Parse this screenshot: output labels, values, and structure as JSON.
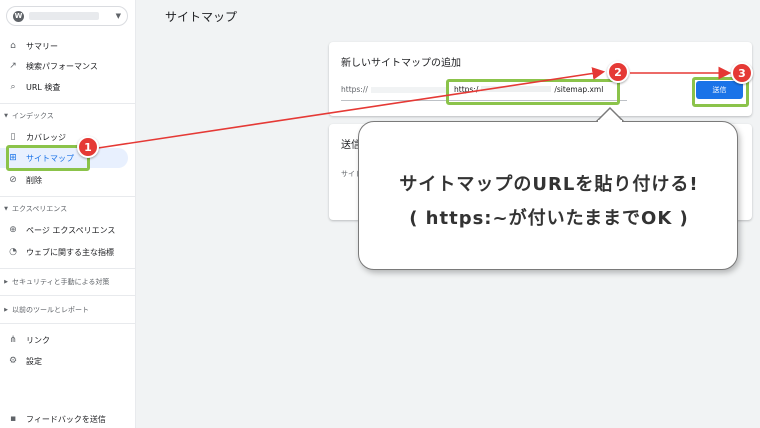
{
  "sidebar": {
    "property_icon": "W",
    "items": {
      "summary": "サマリー",
      "performance": "検索パフォーマンス",
      "url_inspect": "URL 検査",
      "coverage": "カバレッジ",
      "sitemaps": "サイトマップ",
      "removals": "削除",
      "page_experience": "ページ エクスペリエンス",
      "web_vitals": "ウェブに関する主な指標",
      "links": "リンク",
      "settings": "設定",
      "feedback": "フィードバックを送信"
    },
    "sections": {
      "index": "インデックス",
      "experience": "エクスペリエンス",
      "security": "セキュリティと手動による対策",
      "legacy": "以前のツールとレポート"
    }
  },
  "main": {
    "page_title": "サイトマップ",
    "add_card": {
      "title": "新しいサイトマップの追加",
      "url_prefix": "https://",
      "field_prefix": "https:/",
      "field_suffix": "/sitemap.xml",
      "submit_label": "送信"
    },
    "submitted_card": {
      "title": "送信",
      "sub": "サイト"
    }
  },
  "annotations": {
    "badges": [
      "1",
      "2",
      "3"
    ],
    "callout_line1": "サイトマップのURLを貼り付ける!",
    "callout_line2": "( https:~が付いたままでOK )",
    "colors": {
      "arrow": "#e53935",
      "highlight": "#8bc34a",
      "accent": "#1a73e8"
    }
  }
}
